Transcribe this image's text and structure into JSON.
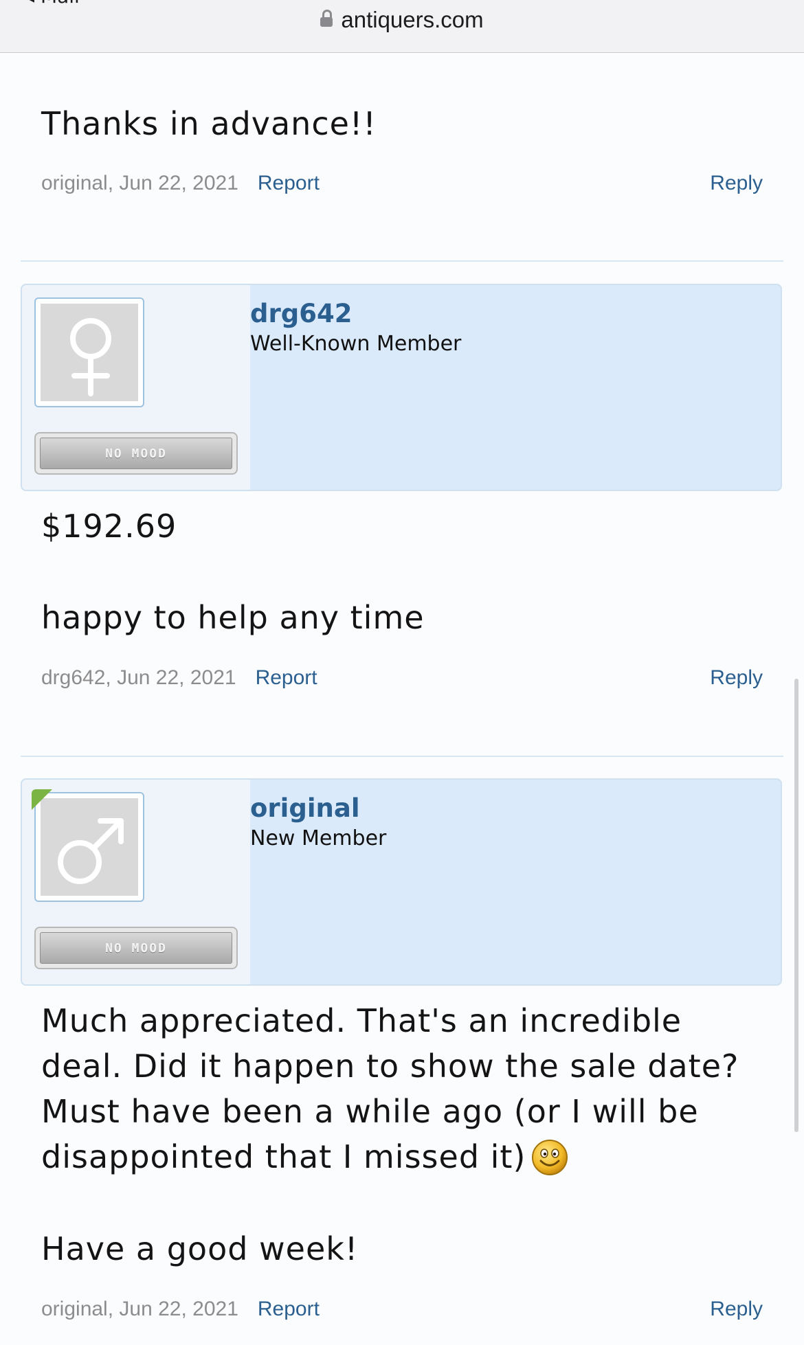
{
  "browser": {
    "back_label": "◂ Mail",
    "url": "antiquers.com"
  },
  "post1": {
    "text": "Thanks in advance!!",
    "byline": "original, Jun 22, 2021",
    "report": "Report",
    "reply": "Reply"
  },
  "post2": {
    "user": {
      "name": "drg642",
      "title": "Well-Known Member",
      "gender_icon": "female-symbol-icon",
      "mood": "NO MOOD"
    },
    "price": "$192.69",
    "text": "happy to help any time",
    "byline": "drg642, Jun 22, 2021",
    "report": "Report",
    "reply": "Reply"
  },
  "post3": {
    "user": {
      "name": "original",
      "title": "New Member",
      "gender_icon": "male-symbol-icon",
      "mood": "NO MOOD",
      "online": true
    },
    "lines": [
      "Much appreciated. That's an incredible",
      "deal. Did it happen to show the sale date?",
      "Must have been a while ago (or I will be",
      "disappointed that I missed it)"
    ],
    "closing": "Have a good week!",
    "byline": "original, Jun 22, 2021",
    "report": "Report",
    "reply": "Reply"
  },
  "colors": {
    "link": "#2a5f8f",
    "userbox_bg": "#dbeafa",
    "online": "#7bb443"
  }
}
